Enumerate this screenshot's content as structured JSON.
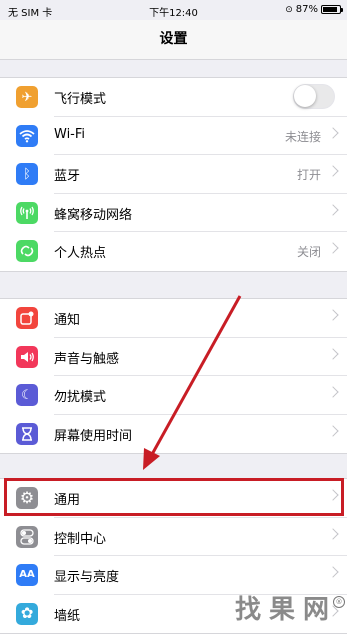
{
  "status_bar": {
    "carrier": "无 SIM 卡",
    "time": "下午12:40",
    "battery": "87%",
    "battery_level": 0.87
  },
  "navbar": {
    "title": "设置"
  },
  "colors": {
    "airplane": "#f0a030",
    "wifi": "#2f7cf6",
    "bluetooth": "#2f7cf6",
    "cellular": "#4cd964",
    "hotspot": "#4cd964",
    "notifications": "#f2453d",
    "sounds": "#f2375a",
    "dnd": "#5b5bd6",
    "screen_time": "#5b5bd6",
    "general": "#8e8e93",
    "control_center": "#8e8e93",
    "display": "#2f7cf6",
    "wallpaper": "#34aadc",
    "highlight": "#c81d25"
  },
  "groups": [
    {
      "items": [
        {
          "label": "飞行模式",
          "icon": "airplane-icon",
          "control": "toggle",
          "toggle_on": false
        },
        {
          "label": "Wi-Fi",
          "icon": "wifi-icon",
          "value": "未连接"
        },
        {
          "label": "蓝牙",
          "icon": "bluetooth-icon",
          "value": "打开"
        },
        {
          "label": "蜂窝移动网络",
          "icon": "antenna-icon"
        },
        {
          "label": "个人热点",
          "icon": "hotspot-link-icon",
          "value": "关闭"
        }
      ]
    },
    {
      "items": [
        {
          "label": "通知",
          "icon": "notification-icon"
        },
        {
          "label": "声音与触感",
          "icon": "speaker-icon"
        },
        {
          "label": "勿扰模式",
          "icon": "moon-icon"
        },
        {
          "label": "屏幕使用时间",
          "icon": "hourglass-icon"
        }
      ]
    },
    {
      "items": [
        {
          "label": "通用",
          "icon": "gear-icon"
        },
        {
          "label": "控制中心",
          "icon": "toggles-icon"
        },
        {
          "label": "显示与亮度",
          "icon": "text-size-icon"
        },
        {
          "label": "墙纸",
          "icon": "flower-icon"
        }
      ]
    }
  ],
  "icon_glyphs": {
    "airplane": "✈",
    "bluetooth": "ᛒ",
    "speaker": "◀",
    "moon": "☾",
    "hourglass": "⧗",
    "gear": "⚙",
    "text_size": "AA",
    "flower": "✿",
    "notification": "●"
  },
  "watermark": {
    "text": "找果网"
  }
}
